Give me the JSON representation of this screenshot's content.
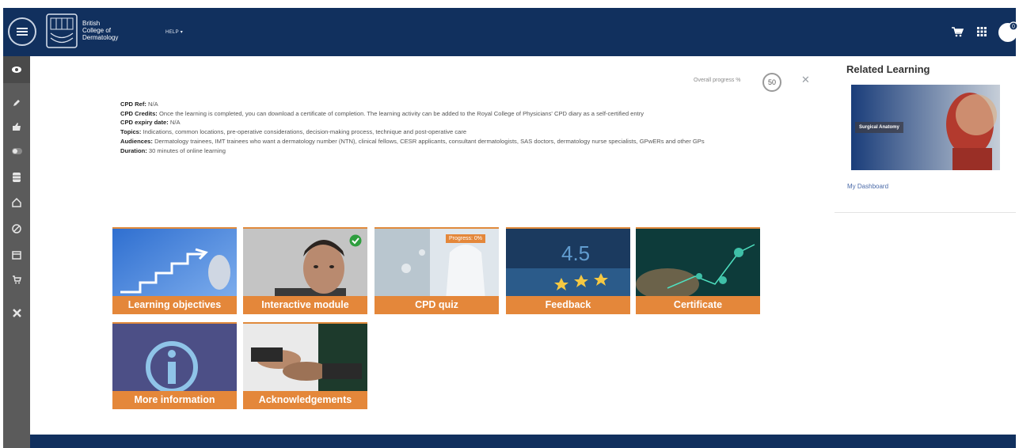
{
  "header": {
    "brand_lines": [
      "British",
      "College of",
      "Dermatology"
    ],
    "help_label": "HELP ▾",
    "avatar_badge": "0"
  },
  "progress": {
    "label": "Overall progress %",
    "value": "50"
  },
  "info": {
    "cpd_ref_label": "CPD Ref:",
    "cpd_ref_value": "N/A",
    "cpd_credits_label": "CPD Credits:",
    "cpd_credits_value": "Once the learning is completed, you can download a certificate of completion. The learning activity can be added to the Royal College of Physicians' CPD diary as a self-certified entry",
    "cpd_expiry_label": "CPD expiry date:",
    "cpd_expiry_value": "N/A",
    "topics_label": "Topics:",
    "topics_value": "Indications, common locations, pre-operative considerations, decision-making process, technique and post-operative care",
    "audiences_label": "Audiences:",
    "audiences_value": "Dermatology trainees, IMT trainees who want a dermatology number (NTN), clinical fellows, CESR applicants, consultant dermatologists, SAS doctors, dermatology nurse specialists, GPwERs and other GPs",
    "duration_label": "Duration:",
    "duration_value": "30 minutes of online learning"
  },
  "tiles": [
    {
      "label": "Learning objectives"
    },
    {
      "label": "Interactive module"
    },
    {
      "label": "CPD quiz",
      "badge": "Progress: 0%"
    },
    {
      "label": "Feedback"
    },
    {
      "label": "Certificate"
    },
    {
      "label": "More information"
    },
    {
      "label": "Acknowledgements"
    }
  ],
  "related": {
    "title": "Related Learning",
    "card_label": "Surgical Anatomy",
    "dashboard_link": "My Dashboard"
  },
  "colors": {
    "header_navy": "#11305e",
    "accent_orange": "#e4873a",
    "rail_grey": "#5b5b5b",
    "completed_green": "#2e9e3e"
  },
  "icons": {
    "menu": "menu-icon",
    "cart": "cart-icon",
    "apps": "apps-grid-icon",
    "avatar": "user-avatar-icon",
    "rail": [
      "eye-icon",
      "pencil-icon",
      "thumbs-up-icon",
      "toggle-icon",
      "database-icon",
      "home-icon",
      "compass-icon",
      "calendar-icon",
      "cart-icon",
      "tools-icon"
    ]
  }
}
